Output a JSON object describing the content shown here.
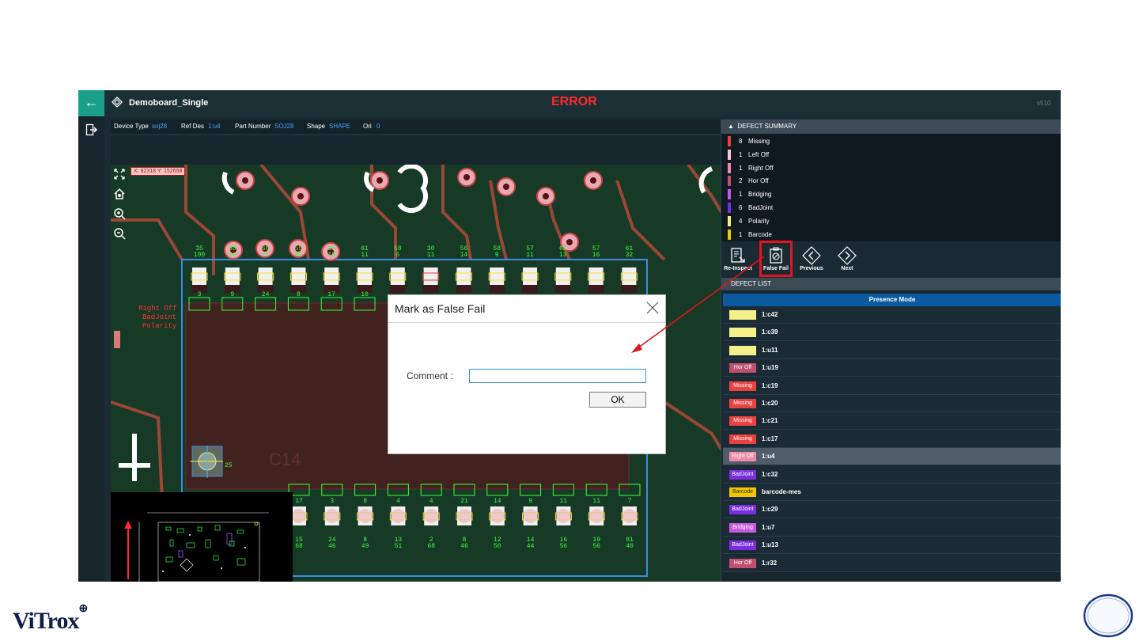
{
  "window": {
    "title": "Demoboard_Single",
    "status": "ERROR",
    "version": "v510",
    "back_icon": "arrow-left-icon",
    "exit_icon": "exit-icon"
  },
  "info_bar": {
    "device_type_label": "Device Type",
    "device_type_value": "soj28",
    "ref_des_label": "Ref Des",
    "ref_des_value": "1:u4",
    "part_number_label": "Part Number",
    "part_number_value": "SOJ28",
    "shape_label": "Shape",
    "shape_value": "SHAPE",
    "ori_label": "Ori",
    "ori_value": "0"
  },
  "viewer": {
    "coordinates": "X: 92318 Y: 152658",
    "tools": [
      "fit-screen-icon",
      "home-icon",
      "zoom-in-icon",
      "zoom-out-icon"
    ],
    "overlay_text": [
      "Right Off",
      "BadJoint",
      "Polarity"
    ],
    "top_pad_labels": [
      "35\n100",
      "68\n16",
      "60\n27",
      "55\n82",
      "15\n15",
      "61\n11",
      "58\n6",
      "30\n11",
      "56\n14",
      "58\n9",
      "57\n11",
      "62\n13",
      "57\n16",
      "61\n32"
    ],
    "top_box_labels": [
      "3",
      "9",
      "24",
      "8",
      "17",
      "10"
    ],
    "bottom_box_labels": [
      "17",
      "3",
      "8",
      "4",
      "4",
      "21",
      "14",
      "9",
      "11",
      "11",
      "7"
    ],
    "bottom_pad_labels": [
      "15\n68",
      "24\n46",
      "8\n49",
      "13\n51",
      "2\n68",
      "8\n46",
      "12\n50",
      "14\n44",
      "16\n56",
      "19\n56",
      "81\n40"
    ],
    "fiducial_label": "25",
    "pcb_text": "C14"
  },
  "defect_summary": {
    "title": "DEFECT SUMMARY",
    "items": [
      {
        "count": "8",
        "name": "Missing",
        "color": "#e84141"
      },
      {
        "count": "1",
        "name": "Left Off",
        "color": "#f7c8d8"
      },
      {
        "count": "1",
        "name": "Right Off",
        "color": "#f08aa8"
      },
      {
        "count": "2",
        "name": "Hor Off",
        "color": "#c05070"
      },
      {
        "count": "1",
        "name": "Bridging",
        "color": "#c75ae0"
      },
      {
        "count": "6",
        "name": "BadJoint",
        "color": "#7a2ee0"
      },
      {
        "count": "4",
        "name": "Polarity",
        "color": "#f4f08a"
      },
      {
        "count": "1",
        "name": "Barcode",
        "color": "#f0c800"
      }
    ]
  },
  "toolbar": {
    "reinspect": "Re-Inspect",
    "false_fail": "False Fail",
    "previous": "Previous",
    "next": "Next"
  },
  "defect_list": {
    "title": "DEFECT LIST",
    "mode": "Presence Mode",
    "rows": [
      {
        "tag": "Polarity",
        "ref": "1:c42",
        "color": "#f4f08a"
      },
      {
        "tag": "Polarity",
        "ref": "1:c39",
        "color": "#f4f08a"
      },
      {
        "tag": "Polarity",
        "ref": "1:u11",
        "color": "#f4f08a"
      },
      {
        "tag": "Hor Off",
        "ref": "1:u19",
        "color": "#c05070"
      },
      {
        "tag": "Missing",
        "ref": "1:c19",
        "color": "#e84141"
      },
      {
        "tag": "Missing",
        "ref": "1:c20",
        "color": "#e84141"
      },
      {
        "tag": "Missing",
        "ref": "1:c21",
        "color": "#e84141"
      },
      {
        "tag": "Missing",
        "ref": "1:c17",
        "color": "#e84141"
      },
      {
        "tag": "Right Off",
        "ref": "1:u4",
        "color": "#f08aa8",
        "selected": true
      },
      {
        "tag": "BadJoint",
        "ref": "1:c32",
        "color": "#7a2ee0"
      },
      {
        "tag": "Barcode",
        "ref": "barcode-mes",
        "color": "#f0c800"
      },
      {
        "tag": "BadJoint",
        "ref": "1:c29",
        "color": "#7a2ee0"
      },
      {
        "tag": "Bridging",
        "ref": "1:u7",
        "color": "#c75ae0"
      },
      {
        "tag": "BadJoint",
        "ref": "1:u13",
        "color": "#7a2ee0"
      },
      {
        "tag": "Hor Off",
        "ref": "1:r32",
        "color": "#c05070"
      }
    ]
  },
  "dialog": {
    "title": "Mark as False Fail",
    "comment_label": "Comment :",
    "comment_value": "",
    "ok_label": "OK",
    "close_icon": "close-icon"
  },
  "footer": {
    "logo_text": "ViTrox",
    "logo_mark": "⊕"
  }
}
